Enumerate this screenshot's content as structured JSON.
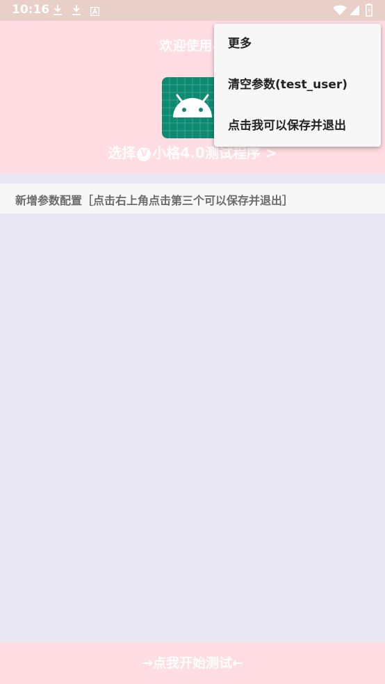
{
  "status_bar": {
    "time": "10:16",
    "left_icons": [
      "download-icon",
      "download-icon",
      "keyboard-a-icon"
    ],
    "right_icons": [
      "wifi-icon",
      "signal-icon",
      "battery-icon"
    ],
    "color": "#e8cfc7"
  },
  "header": {
    "welcome_text": "欢迎使用小",
    "select_prefix": "选择",
    "select_badge": "V",
    "select_suffix": "小格4.0测试程序 >",
    "color": "#ffdde2"
  },
  "config": {
    "label": "新增参数配置［点击右上角点击第三个可以保存并退出］"
  },
  "start_button": {
    "label": "→点我开始测试←"
  },
  "menu": {
    "items": [
      {
        "label": "更多"
      },
      {
        "label": "清空参数(test_user)"
      },
      {
        "label": "点击我可以保存并退出"
      }
    ]
  },
  "colors": {
    "background": "#e8e7f2",
    "app_icon": "#0f8a72"
  }
}
